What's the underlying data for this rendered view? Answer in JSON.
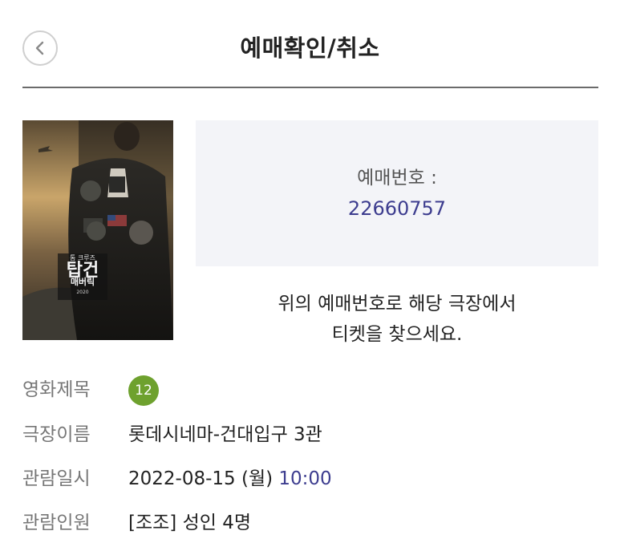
{
  "header": {
    "title": "예매확인/취소",
    "back_icon": "chevron-left-icon"
  },
  "poster": {
    "title_text": "탑건",
    "subtitle_text": "매버릭",
    "top_text": "톰 크루즈",
    "year_text": "2020"
  },
  "booking": {
    "label": "예매번호 :",
    "number": "22660757"
  },
  "notice": {
    "line1": "위의 예매번호로 해당 극장에서",
    "line2": "티켓을 찾으세요."
  },
  "info": {
    "movie_title_label": "영화제목",
    "age_rating": "12",
    "theater_label": "극장이름",
    "theater_value": "롯데시네마-건대입구 3관",
    "datetime_label": "관람일시",
    "date_value": "2022-08-15 (월)",
    "time_value": "10:00",
    "audience_label": "관람인원",
    "audience_value": "[조조] 성인 4명"
  },
  "colors": {
    "accent": "#3d3d8f",
    "rating_badge": "#6ea12e",
    "box_bg": "#f3f4f8"
  }
}
